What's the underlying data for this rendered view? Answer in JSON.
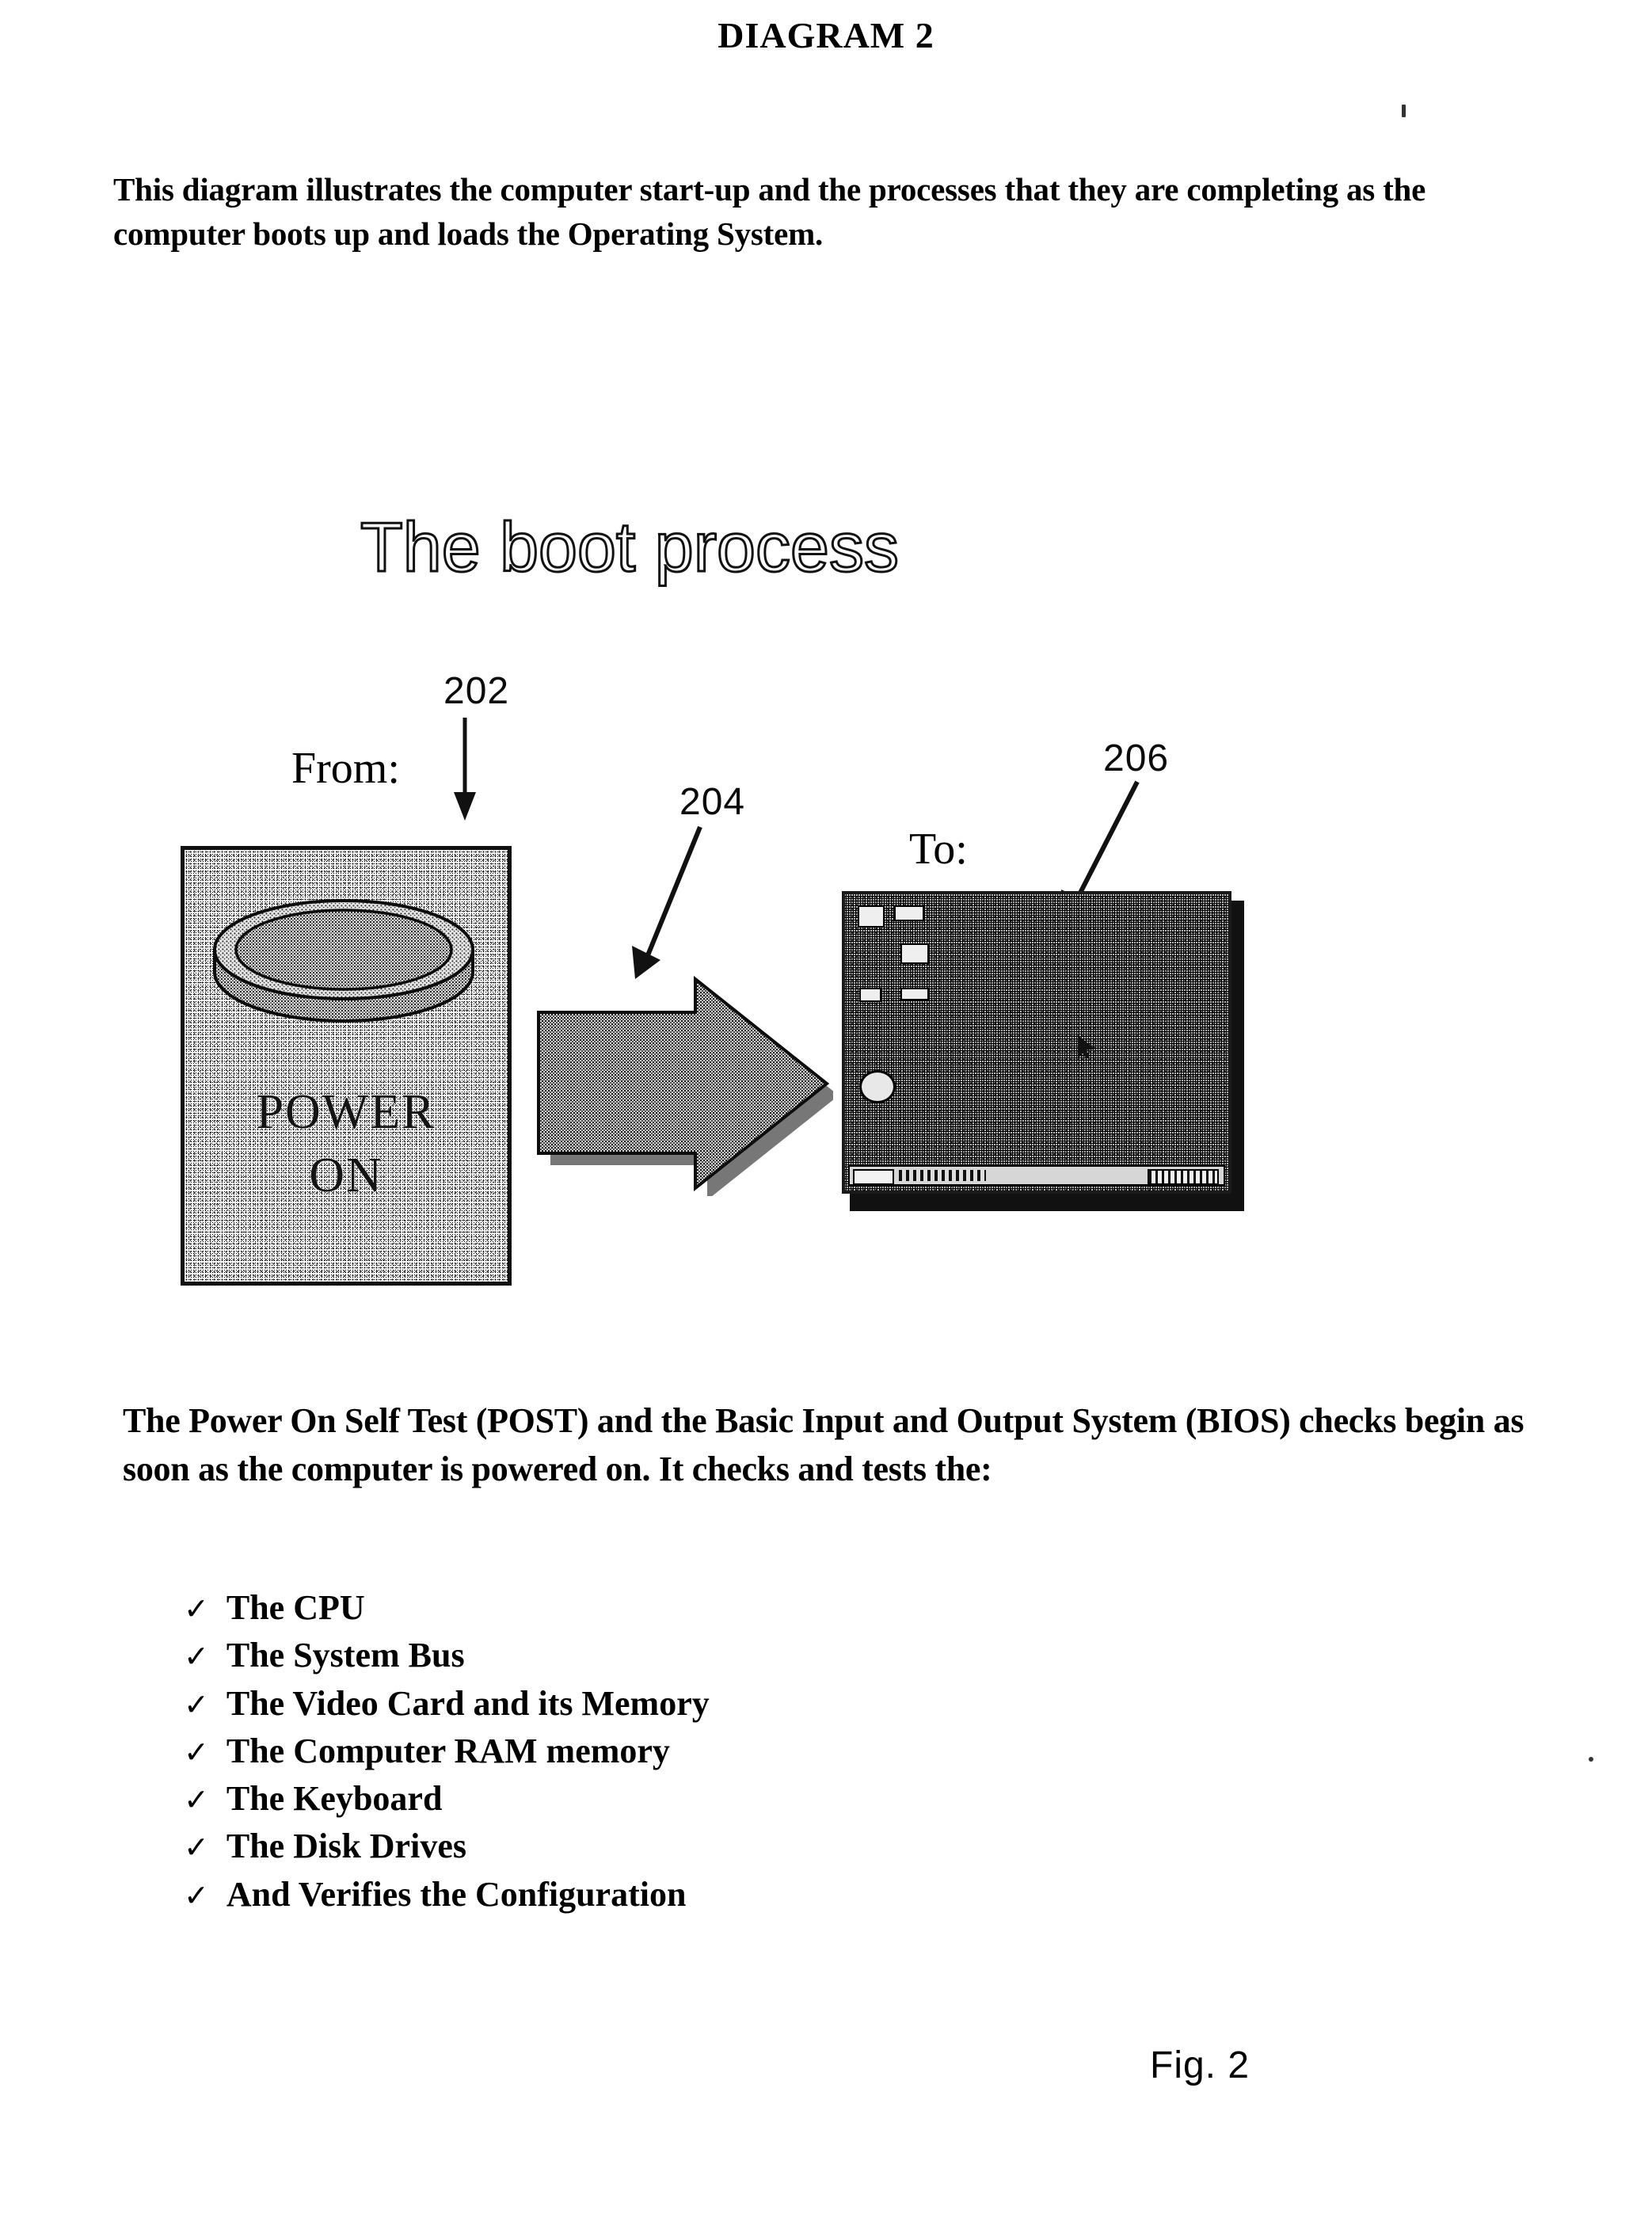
{
  "document": {
    "title": "DIAGRAM 2",
    "intro_paragraph": "This diagram illustrates the computer start-up and the processes that they are completing as the computer boots up and loads the Operating System.",
    "figure_caption": "Fig. 2"
  },
  "figure": {
    "display_title": "The boot process",
    "from_label": "From:",
    "to_label": "To:",
    "reference_numerals": {
      "power_on": "202",
      "transition_arrow": "204",
      "desktop": "206"
    },
    "power_panel": {
      "line1": "POWER",
      "line2": "ON",
      "icon": "power-button-icon"
    },
    "desktop_panel": {
      "icon": "windows-desktop-screenshot",
      "taskbar": "windows-taskbar"
    },
    "block_arrow_icon": "right-block-arrow-icon"
  },
  "body": {
    "post_paragraph": "The Power On Self Test (POST) and the Basic Input and Output System (BIOS) checks begin as soon as the computer is powered on. It checks and tests the:",
    "check_mark": "✓",
    "checks": [
      "The CPU",
      "The System Bus",
      "The Video Card and its Memory",
      "The Computer RAM memory",
      "The Keyboard",
      "The Disk Drives",
      "And Verifies the Configuration"
    ]
  },
  "colors": {
    "ink": "#111111",
    "paper": "#ffffff",
    "halftone": "#2a2a2a"
  }
}
